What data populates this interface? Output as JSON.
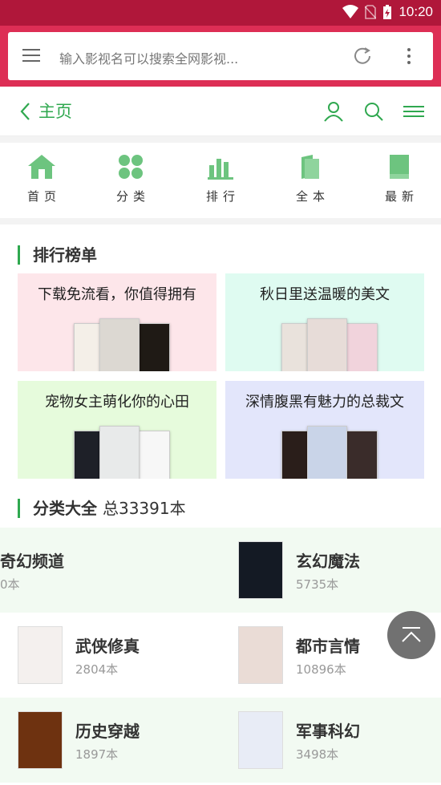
{
  "status": {
    "time": "10:20"
  },
  "browser": {
    "search_placeholder": "输入影视名可以搜索全网影视..."
  },
  "header": {
    "title": "主页"
  },
  "nav": [
    {
      "label": "首页",
      "icon": "home-icon"
    },
    {
      "label": "分类",
      "icon": "grid-dots-icon"
    },
    {
      "label": "排行",
      "icon": "bar-chart-icon"
    },
    {
      "label": "全本",
      "icon": "book-icon"
    },
    {
      "label": "最新",
      "icon": "bookmark-book-icon"
    }
  ],
  "rank": {
    "title": "排行榜单",
    "cards": [
      {
        "label": "下载免流看，你值得拥有",
        "bg": "#fde6ea"
      },
      {
        "label": "秋日里送温暖的美文",
        "bg": "#dffbf1"
      },
      {
        "label": "宠物女主萌化你的心田",
        "bg": "#e6fbdc"
      },
      {
        "label": "深情腹黑有魅力的总裁文",
        "bg": "#e3e6fb"
      }
    ]
  },
  "categories": {
    "title": "分类大全",
    "total_text": "总33391本",
    "items": [
      {
        "name": "奇幻频道",
        "count": "0本"
      },
      {
        "name": "玄幻魔法",
        "count": "5735本"
      },
      {
        "name": "武侠修真",
        "count": "2804本"
      },
      {
        "name": "都市言情",
        "count": "10896本"
      },
      {
        "name": "历史穿越",
        "count": "1897本"
      },
      {
        "name": "军事科幻",
        "count": "3498本"
      }
    ]
  },
  "colors": {
    "accent": "#2fa84f",
    "browser_bar": "#dd2e55",
    "status_bar": "#b0173a",
    "row_tint": "#f2faf2"
  }
}
